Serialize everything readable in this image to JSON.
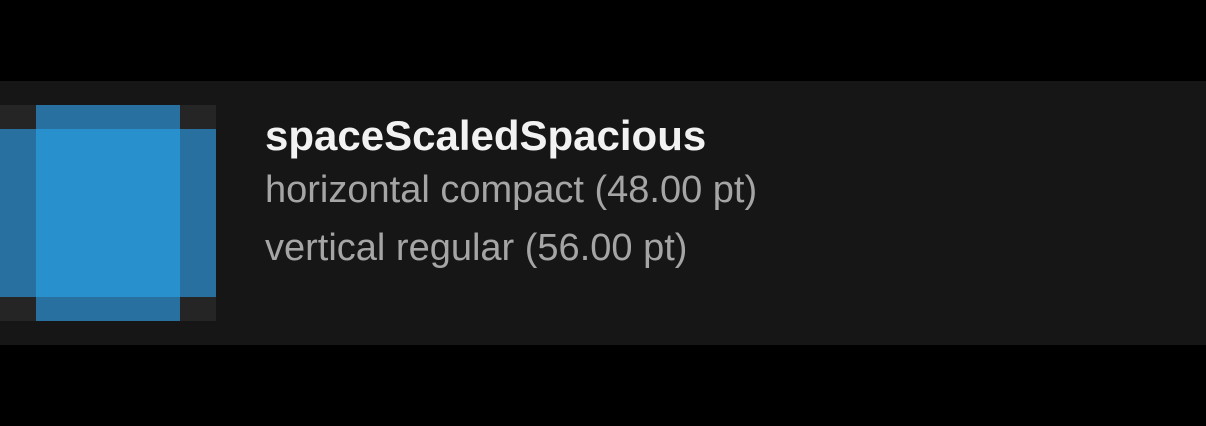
{
  "item": {
    "title": "spaceScaledSpacious",
    "horizontal": "horizontal compact (48.00 pt)",
    "vertical": "vertical regular (56.00 pt)"
  },
  "colors": {
    "background": "#000000",
    "card": "#161616",
    "swatch_base": "#252525",
    "swatch_band": "#28709f",
    "swatch_core": "#2890cc",
    "title_text": "#f2f2f2",
    "detail_text": "#a5a5a5"
  }
}
